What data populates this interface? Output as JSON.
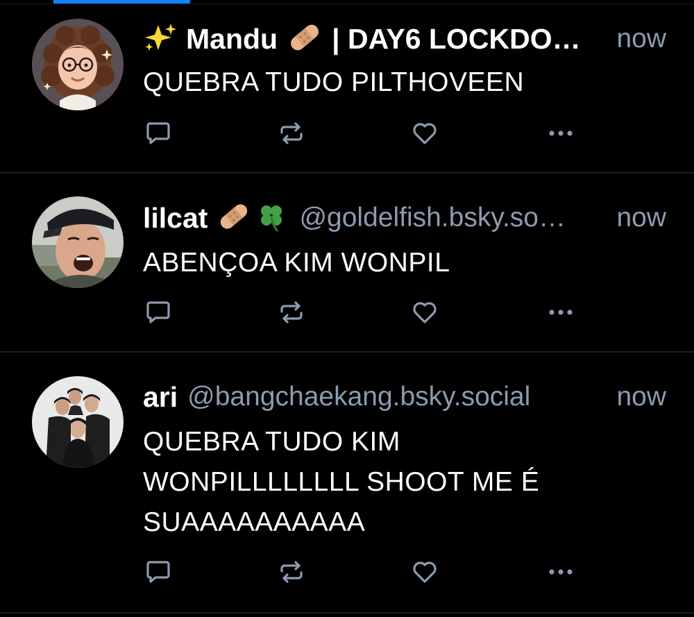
{
  "colors": {
    "background": "#000000",
    "accent": "#1083fe",
    "muted_text": "#8c9bb0",
    "divider": "#1b1f25",
    "icon": "#8c9bb0"
  },
  "posts": [
    {
      "display_name": "Mandu",
      "name_suffix": "| DAY6 LOCKDO…",
      "handle": "",
      "timestamp": "now",
      "text": "QUEBRA TUDO PILTHOVEEN",
      "emojis": [
        "sparkles-emoji",
        "bandage-emoji"
      ]
    },
    {
      "display_name": "lilcat",
      "name_suffix": "",
      "handle": "@goldelfish.bsky.so…",
      "timestamp": "now",
      "text": "ABENÇOA KIM WONPIL",
      "emojis": [
        "bandage-emoji",
        "four-leaf-clover-emoji"
      ]
    },
    {
      "display_name": "ari",
      "name_suffix": "",
      "handle": "@bangchaekang.bsky.social",
      "timestamp": "now",
      "text": "QUEBRA TUDO KIM WONPILLLLLLLL SHOOT ME É SUAAAAAAAAAA",
      "emojis": []
    }
  ],
  "actions": [
    "reply-icon",
    "repost-icon",
    "like-icon",
    "more-icon"
  ]
}
